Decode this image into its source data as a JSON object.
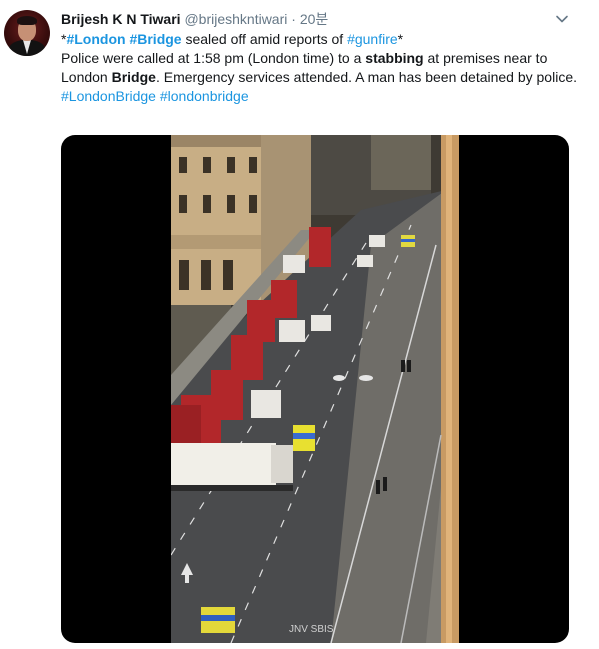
{
  "user": {
    "display_name": "Brijesh K N Tiwari",
    "handle": "@brijeshkntiwari",
    "separator": "·",
    "time": "20분"
  },
  "tweet": {
    "line1": {
      "t1": "*",
      "h1": "#London",
      "t2": " ",
      "h2": "#Bridge",
      "t3": " sealed off amid reports of ",
      "h3": "#gunfire",
      "t4": "*"
    },
    "line2": {
      "t1": "Police were called at 1:58 pm (London time) to a ",
      "b1": "stabbing",
      "t2": " at premises near to London ",
      "b2": "Bridge",
      "t3": ". Emergency services attended. A man has been detained by police."
    },
    "hashtags": {
      "h1": "#LondonBridge",
      "h2": "#londonbridge"
    }
  },
  "media": {
    "road_marking": "JNV SBIS"
  },
  "colors": {
    "link": "#1b95e0",
    "text": "#14171a",
    "muted": "#657786",
    "media_bg": "#000000"
  },
  "icons": {
    "more": "chevron-down-icon"
  }
}
